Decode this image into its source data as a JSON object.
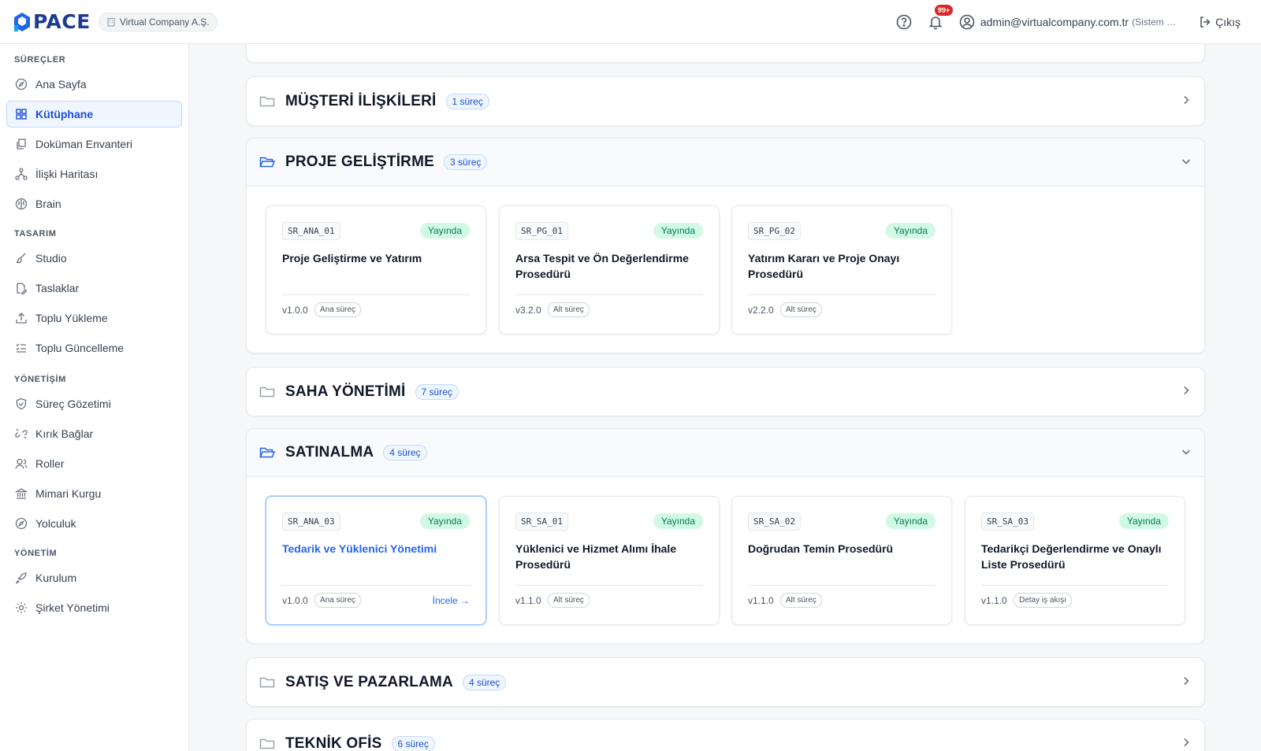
{
  "header": {
    "logo_text": "PACE",
    "company": "Virtual Company A.Ş.",
    "notification_badge": "99+",
    "user_email": "admin@virtualcompany.com.tr",
    "user_role": "(Sistem …",
    "logout_label": "Çıkış"
  },
  "sidebar": {
    "sections": [
      {
        "title": "SÜREÇLER"
      },
      {
        "title": "TASARIM"
      },
      {
        "title": "YÖNETİŞİM"
      },
      {
        "title": "YÖNETİM"
      }
    ],
    "items": [
      {
        "label": "Ana Sayfa",
        "icon": "compass-icon"
      },
      {
        "label": "Kütüphane",
        "icon": "grid-icon",
        "active": true
      },
      {
        "label": "Doküman Envanteri",
        "icon": "documents-icon"
      },
      {
        "label": "İlişki Haritası",
        "icon": "network-icon"
      },
      {
        "label": "Brain",
        "icon": "brain-icon"
      },
      {
        "label": "Studio",
        "icon": "brush-icon"
      },
      {
        "label": "Taslaklar",
        "icon": "draft-icon"
      },
      {
        "label": "Toplu Yükleme",
        "icon": "upload-icon"
      },
      {
        "label": "Toplu Güncelleme",
        "icon": "checklist-icon"
      },
      {
        "label": "Süreç Gözetimi",
        "icon": "shield-icon"
      },
      {
        "label": "Kırık Bağlar",
        "icon": "broken-link-icon"
      },
      {
        "label": "Roller",
        "icon": "users-icon"
      },
      {
        "label": "Mimari Kurgu",
        "icon": "institution-icon"
      },
      {
        "label": "Yolculuk",
        "icon": "compass-icon"
      },
      {
        "label": "Kurulum",
        "icon": "rocket-icon"
      },
      {
        "label": "Şirket Yönetimi",
        "icon": "gear-icon"
      }
    ]
  },
  "categories": [
    {
      "name": "MÜŞTERİ İLİŞKİLERİ",
      "count": "1 süreç",
      "expanded": false
    },
    {
      "name": "PROJE GELİŞTİRME",
      "count": "3 süreç",
      "expanded": true,
      "cards": [
        {
          "code": "SR_ANA_01",
          "status": "Yayında",
          "title": "Proje Geliştirme ve Yatırım",
          "version": "v1.0.0",
          "type": "Ana süreç"
        },
        {
          "code": "SR_PG_01",
          "status": "Yayında",
          "title": "Arsa Tespit ve Ön Değerlendirme Prosedürü",
          "version": "v3.2.0",
          "type": "Alt süreç"
        },
        {
          "code": "SR_PG_02",
          "status": "Yayında",
          "title": "Yatırım Kararı ve Proje Onayı Prosedürü",
          "version": "v2.2.0",
          "type": "Alt süreç"
        }
      ]
    },
    {
      "name": "SAHA YÖNETİMİ",
      "count": "7 süreç",
      "expanded": false
    },
    {
      "name": "SATINALMA",
      "count": "4 süreç",
      "expanded": true,
      "cards": [
        {
          "code": "SR_ANA_03",
          "status": "Yayında",
          "title": "Tedarik ve Yüklenici Yönetimi",
          "version": "v1.0.0",
          "type": "Ana süreç",
          "action": "İncele →"
        },
        {
          "code": "SR_SA_01",
          "status": "Yayında",
          "title": "Yüklenici ve Hizmet Alımı İhale Prosedürü",
          "version": "v1.1.0",
          "type": "Alt süreç"
        },
        {
          "code": "SR_SA_02",
          "status": "Yayında",
          "title": "Doğrudan Temin Prosedürü",
          "version": "v1.1.0",
          "type": "Alt süreç"
        },
        {
          "code": "SR_SA_03",
          "status": "Yayında",
          "title": "Tedarikçi Değerlendirme ve Onaylı Liste Prosedürü",
          "version": "v1.1.0",
          "type": "Detay iş akışı"
        }
      ]
    },
    {
      "name": "SATIŞ VE PAZARLAMA",
      "count": "4 süreç",
      "expanded": false
    },
    {
      "name": "TEKNİK OFİS",
      "count": "6 süreç",
      "expanded": false
    }
  ],
  "colors": {
    "accent": "#2563eb",
    "published": "#047857",
    "badge": "#dc2626"
  }
}
